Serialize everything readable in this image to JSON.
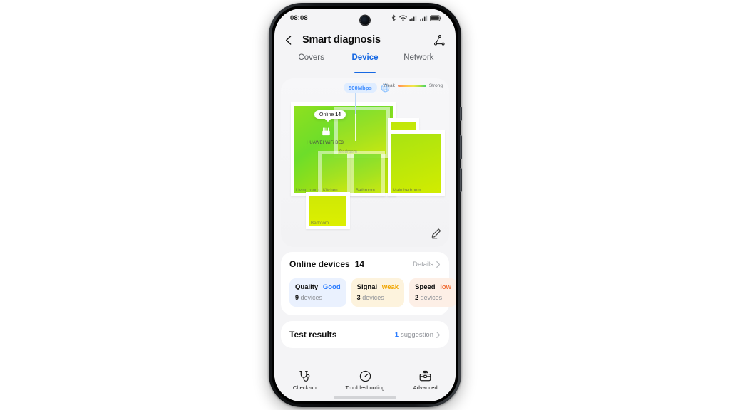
{
  "statusbar": {
    "time": "08:08",
    "icons": [
      "bluetooth-icon",
      "wifi-icon",
      "signal-icon",
      "signal-icon",
      "battery-icon"
    ]
  },
  "appbar": {
    "back_icon": "back-arrow-icon",
    "title": "Smart diagnosis",
    "action_icon": "share-topology-icon"
  },
  "tabs": [
    {
      "label": "Covers",
      "active": false
    },
    {
      "label": "Device",
      "active": true
    },
    {
      "label": "Network",
      "active": false
    }
  ],
  "map": {
    "speed_badge": "500Mbps",
    "globe_icon": "globe-icon",
    "legend_weak": "Weak",
    "legend_strong": "Strong",
    "legend_gradient_from": "#ff8a5c",
    "legend_gradient_to": "#3fd16a",
    "router_bubble_label": "Online",
    "router_bubble_count": "14",
    "router_name": "HUAWEI WiFi BE3",
    "router_icon": "router-icon",
    "edit_icon": "edit-pencil-icon",
    "rooms": [
      {
        "name": "Living room"
      },
      {
        "name": "Bedroom"
      },
      {
        "name": "Balcony"
      },
      {
        "name": "Kitchen"
      },
      {
        "name": "Bathroom"
      },
      {
        "name": "Main bedroom"
      },
      {
        "name": "Bedroom"
      }
    ]
  },
  "devices_card": {
    "title": "Online devices",
    "count": "14",
    "details_label": "Details",
    "chevron_icon": "chevron-right-icon",
    "stats": [
      {
        "label": "Quality",
        "value": "Good",
        "count": "9",
        "unit": "devices"
      },
      {
        "label": "Signal",
        "value": "weak",
        "count": "3",
        "unit": "devices"
      },
      {
        "label": "Speed",
        "value": "low",
        "count": "2",
        "unit": "devices"
      }
    ]
  },
  "test_results": {
    "title": "Test results",
    "count": "1",
    "suffix": "suggestion",
    "chevron_icon": "chevron-right-icon"
  },
  "bottom_nav": [
    {
      "label": "Check-up",
      "icon": "stethoscope-icon"
    },
    {
      "label": "Troubleshooting",
      "icon": "gauge-icon"
    },
    {
      "label": "Advanced",
      "icon": "toolbox-icon"
    }
  ],
  "colors": {
    "accent_blue": "#1668e3",
    "heat_strong": "#3fd16a",
    "heat_weak": "#ff8a5c"
  }
}
